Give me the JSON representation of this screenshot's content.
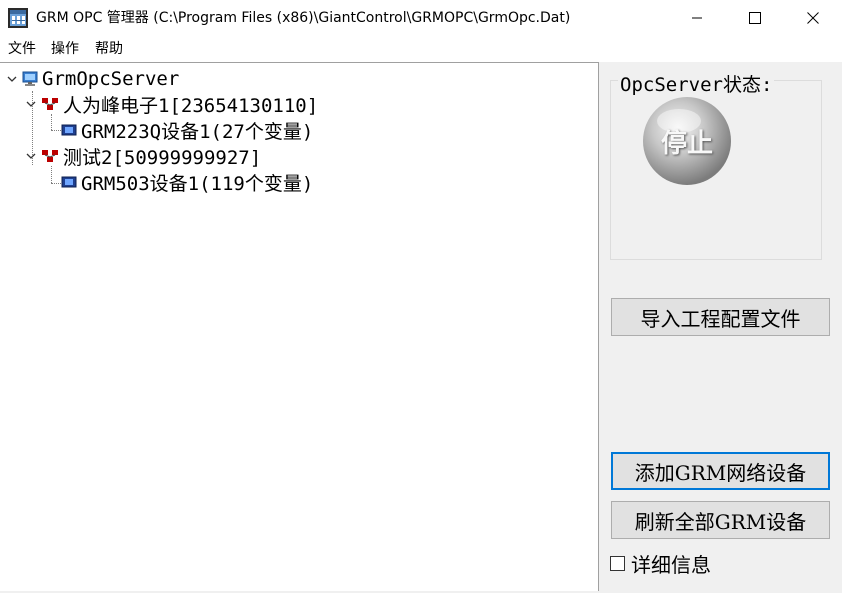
{
  "window": {
    "title": "GRM OPC 管理器  (C:\\Program Files (x86)\\GiantControl\\GRMOPC\\GrmOpc.Dat)",
    "icon": "app-grid-icon"
  },
  "menu": {
    "items": [
      "文件",
      "操作",
      "帮助"
    ]
  },
  "tree": {
    "root": "GrmOpcServer",
    "groups": [
      {
        "label": "人为峰电子1[23654130110]",
        "device": "GRM223Q设备1(27个变量)"
      },
      {
        "label": "测试2[50999999927]",
        "device": "GRM503设备1(119个变量)"
      }
    ]
  },
  "status": {
    "group_title": "OpcServer状态:",
    "state_label": "停止"
  },
  "buttons": {
    "import_config": "导入工程配置文件",
    "add_device": "添加GRM网络设备",
    "refresh_all": "刷新全部GRM设备"
  },
  "details": {
    "checkbox_label": "详细信息",
    "checked": false
  },
  "colors": {
    "focus_border": "#0078d7",
    "tree_bg": "#ffffff",
    "panel_bg": "#f0f0f0"
  }
}
